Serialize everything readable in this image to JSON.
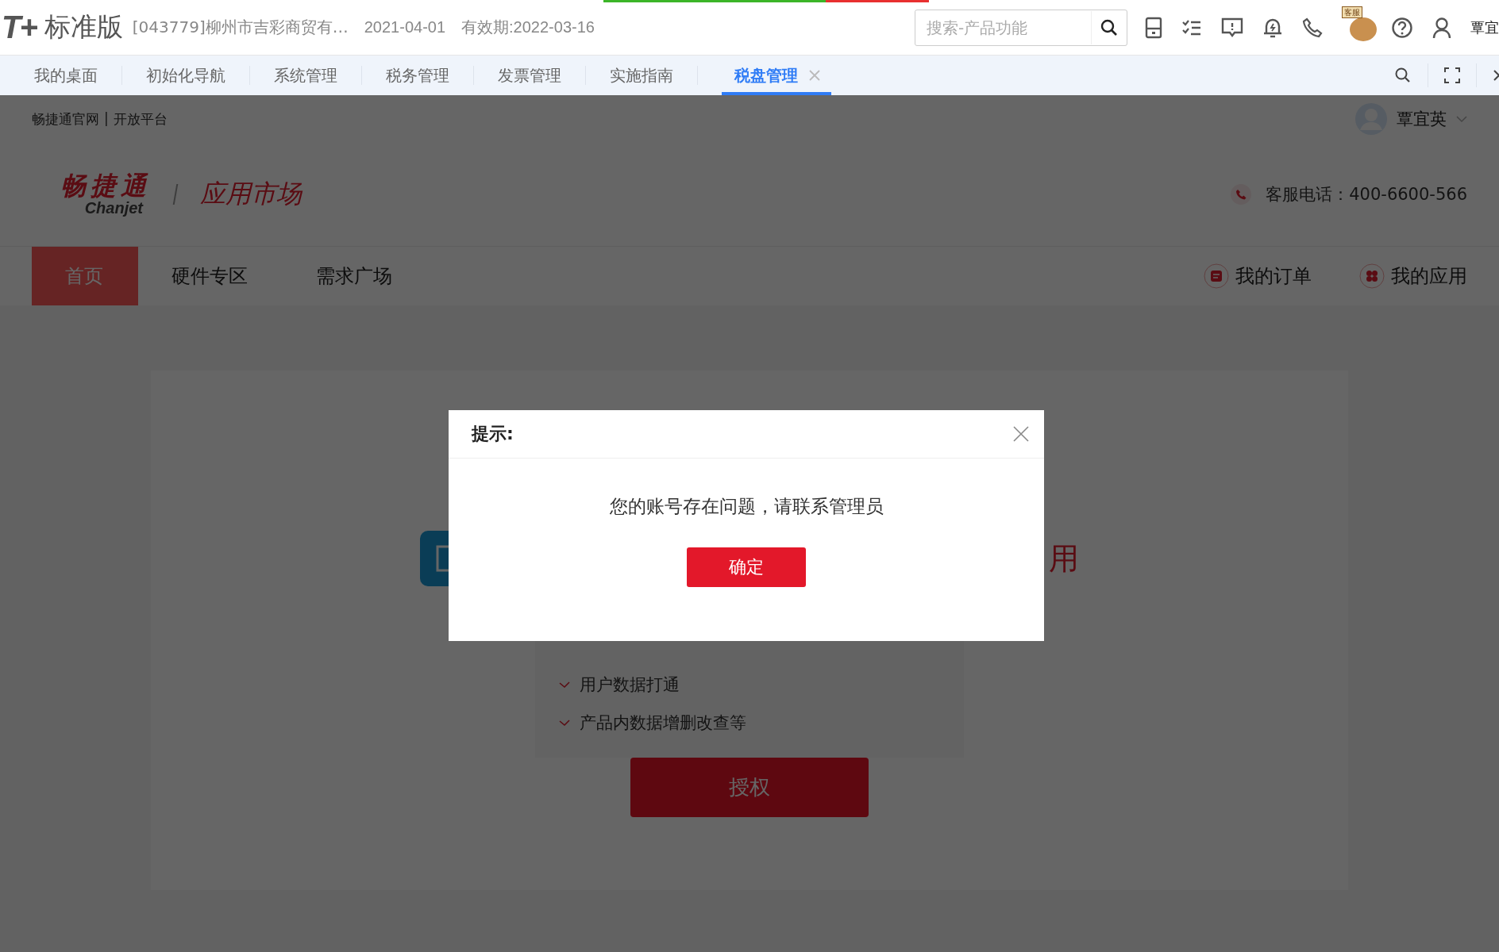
{
  "topbar": {
    "logo": "T+",
    "edition": "标准版",
    "company": "[043779]柳州市吉彩商贸有…",
    "date": "2021-04-01",
    "expiry": "有效期:2022-03-16",
    "search": {
      "placeholder": "搜索-产品功能"
    },
    "mascot_sign": "客服",
    "user": "覃宜"
  },
  "tabs": [
    {
      "label": "我的桌面",
      "selected": false,
      "closable": false
    },
    {
      "label": "初始化导航",
      "selected": false,
      "closable": false
    },
    {
      "label": "系统管理",
      "selected": false,
      "closable": false
    },
    {
      "label": "税务管理",
      "selected": false,
      "closable": false
    },
    {
      "label": "发票管理",
      "selected": false,
      "closable": false
    },
    {
      "label": "实施指南",
      "selected": false,
      "closable": false
    },
    {
      "label": "税盘管理",
      "selected": true,
      "closable": true
    }
  ],
  "market": {
    "links": [
      "畅捷通官网",
      "开放平台"
    ],
    "links_separator": "|",
    "user": "覃宜英",
    "logo_cn": "畅捷通",
    "logo_en": "Chanjet",
    "title": "应用市场",
    "hotline": "客服电话：400-6600-566",
    "nav": [
      {
        "label": "首页",
        "selected": true
      },
      {
        "label": "硬件专区",
        "selected": false
      },
      {
        "label": "需求广场",
        "selected": false
      }
    ],
    "actions": [
      {
        "label": "我的订单",
        "kind": "order"
      },
      {
        "label": "我的应用",
        "kind": "apps"
      }
    ],
    "app_title": "用",
    "permissions": [
      "用户数据打通",
      "产品内数据增删改查等"
    ],
    "authorize": "授权"
  },
  "dialog": {
    "title": "提示:",
    "message": "您的账号存在问题，请联系管理员",
    "confirm": "确定"
  }
}
